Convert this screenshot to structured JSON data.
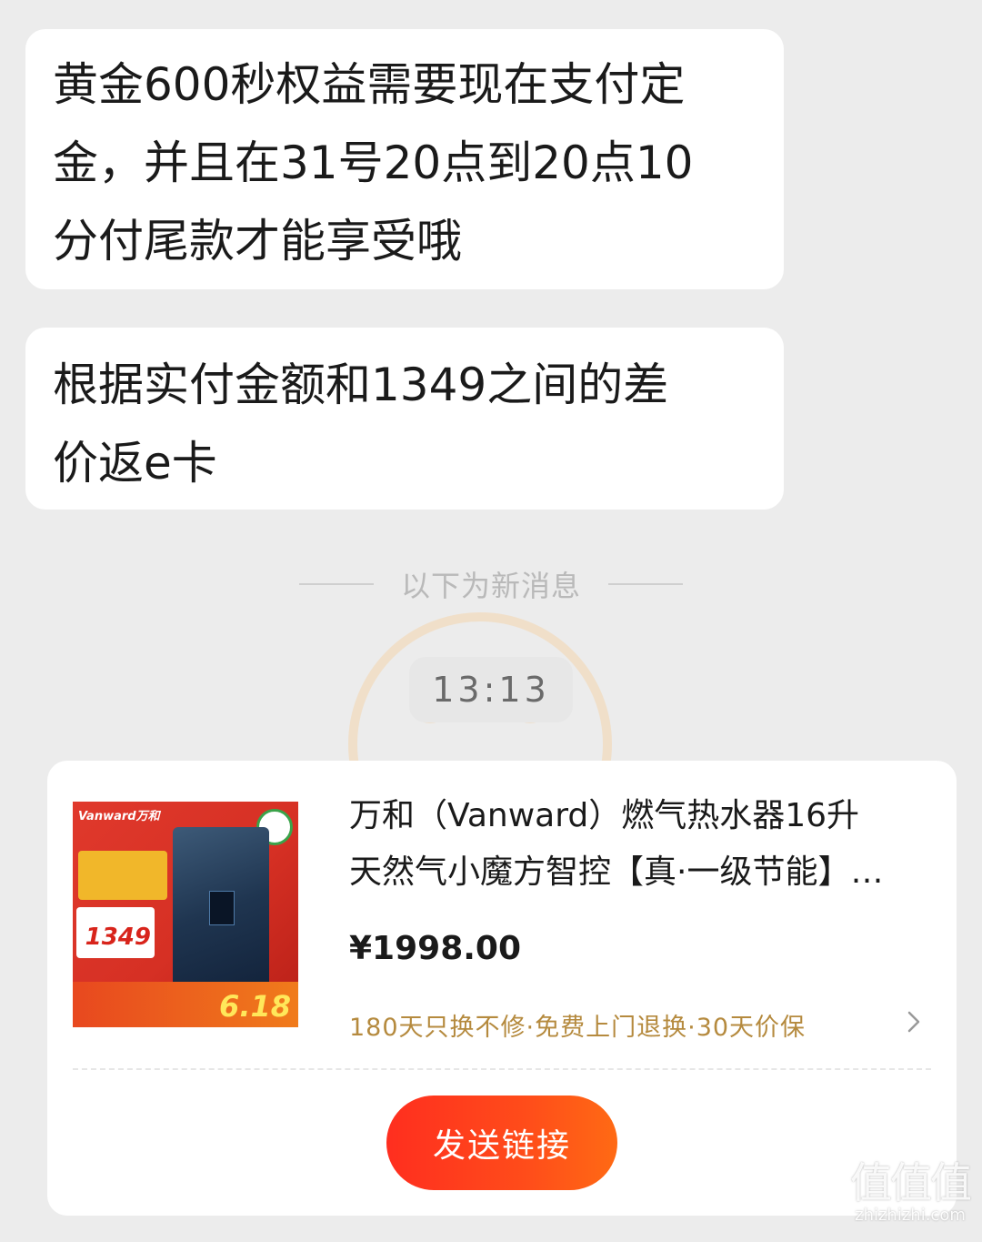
{
  "messages": [
    {
      "text": "黄金600秒权益需要现在支付定\n金，并且在31号20点到20点10\n分付尾款才能享受哦"
    },
    {
      "text": "根据实付金额和1349之间的差\n价返e卡"
    }
  ],
  "divider_text": "以下为新消息",
  "timestamp": "13:13",
  "product_card": {
    "title_line1": "万和（Vanward）燃气热水器16升",
    "title_line2": "天然气小魔方智控【真·一级节能】…",
    "price": "¥1998.00",
    "guarantee": "180天只换不修·免费上门退换·30天价保",
    "send_button": "发送链接",
    "thumbnail": {
      "brand": "Vanward万和",
      "price_tag": "1349",
      "badge": "6.18"
    }
  },
  "watermark": {
    "site": "值值值",
    "domain": "zhizhizhi.com"
  },
  "colors": {
    "background": "#ececec",
    "accent_button": "#ff3b1d",
    "guarantee_text": "#b58a3e"
  }
}
